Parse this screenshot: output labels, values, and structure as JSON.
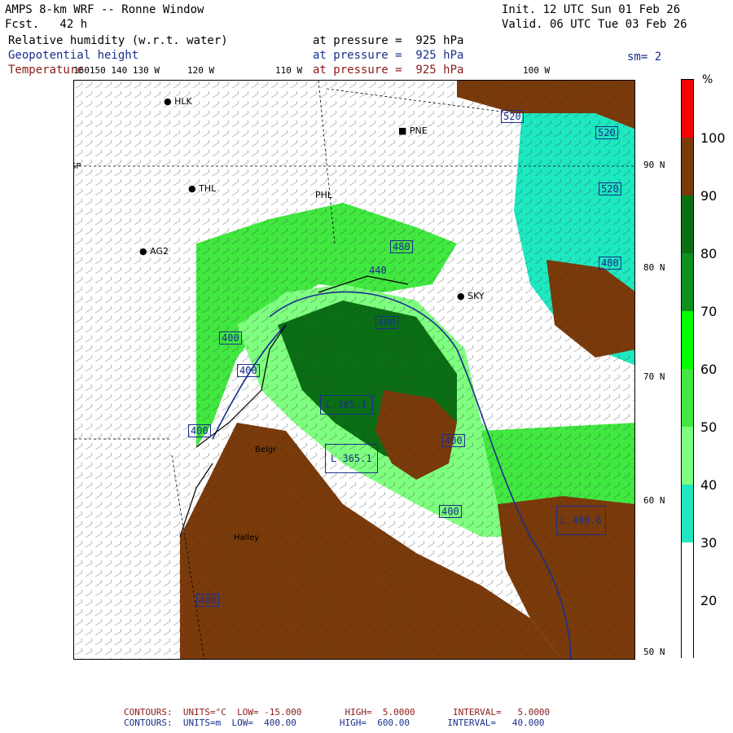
{
  "header": {
    "title": "AMPS 8-km WRF -- Ronne Window",
    "fcst": "Fcst.   42 h",
    "init": "Init. 12 UTC Sun 01 Feb 26",
    "valid": "Valid. 06 UTC Tue 03 Feb 26",
    "field1_label": "Relative humidity (w.r.t. water)",
    "field2_label": "Geopotential height",
    "field3_label": "Temperature",
    "pressure_text": "at pressure =  925 hPa",
    "sm_text": "sm= 2"
  },
  "colorbar": {
    "unit": "%",
    "labels": [
      "100",
      "90",
      "80",
      "70",
      "60",
      "50",
      "40",
      "30",
      "20"
    ],
    "colors": [
      "#ff0000",
      "#7a3a0a",
      "#0a6e14",
      "#0f8f1f",
      "#00ff00",
      "#40e840",
      "#7fff7f",
      "#1ee8c0",
      "#ffffff"
    ]
  },
  "lat_labels": [
    "90 N",
    "80 N",
    "70 N",
    "60 N",
    "50 N"
  ],
  "lon_labels": [
    "160150 140 130 W",
    "120 W",
    "110 W",
    "100 W"
  ],
  "stations": [
    "HLK",
    "PNE",
    "THL",
    "PHL",
    "AG2",
    "SKY",
    "Belgr",
    "Halley"
  ],
  "left_edge_label": "SP",
  "height_boxes": [
    "520",
    "520",
    "520",
    "480",
    "480",
    "440",
    "400",
    "400",
    "400",
    "400",
    "400",
    "400",
    "400"
  ],
  "low_boxes": [
    "L 365.1",
    "L 365.1",
    "L 400.6"
  ],
  "footer": {
    "line1": "CONTOURS:  UNITS=°C  LOW= -15.000        HIGH=  5.0000       INTERVAL=   5.0000",
    "line2": "CONTOURS:  UNITS=m  LOW=  400.00        HIGH=  600.00       INTERVAL=   40.000"
  }
}
